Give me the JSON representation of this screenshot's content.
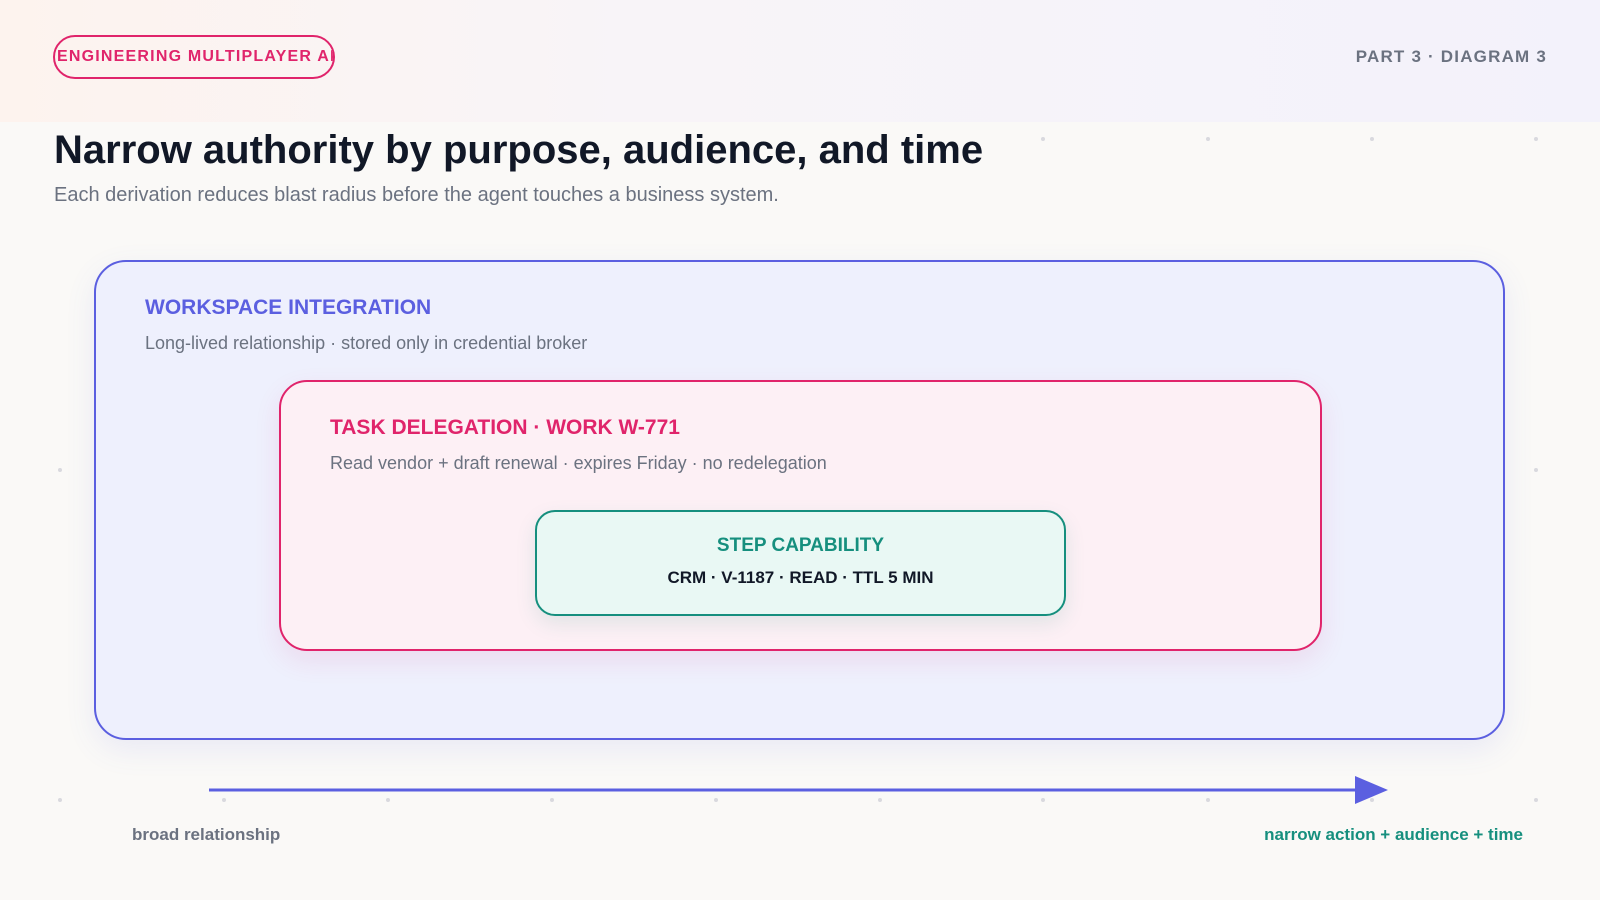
{
  "header": {
    "badge": "ENGINEERING MULTIPLAYER AI",
    "part_label": "PART 3 · DIAGRAM 3"
  },
  "title": "Narrow authority by purpose, audience, and time",
  "subtitle": "Each derivation reduces blast radius before the agent touches a business system.",
  "layers": {
    "workspace": {
      "title": "WORKSPACE INTEGRATION",
      "description": "Long-lived relationship · stored only in credential broker"
    },
    "task": {
      "title": "TASK DELEGATION · WORK W-771",
      "description": "Read vendor + draft renewal · expires Friday · no redelegation"
    },
    "step": {
      "title": "STEP CAPABILITY",
      "description": "CRM · V-1187 · READ · TTL 5 MIN"
    }
  },
  "axis": {
    "left_label": "broad relationship",
    "right_label": "narrow action + audience + time"
  },
  "colors": {
    "indigo": "#5b5fe0",
    "pink": "#e0246b",
    "teal": "#168f7e",
    "muted": "#6b7280",
    "ink": "#111827"
  }
}
